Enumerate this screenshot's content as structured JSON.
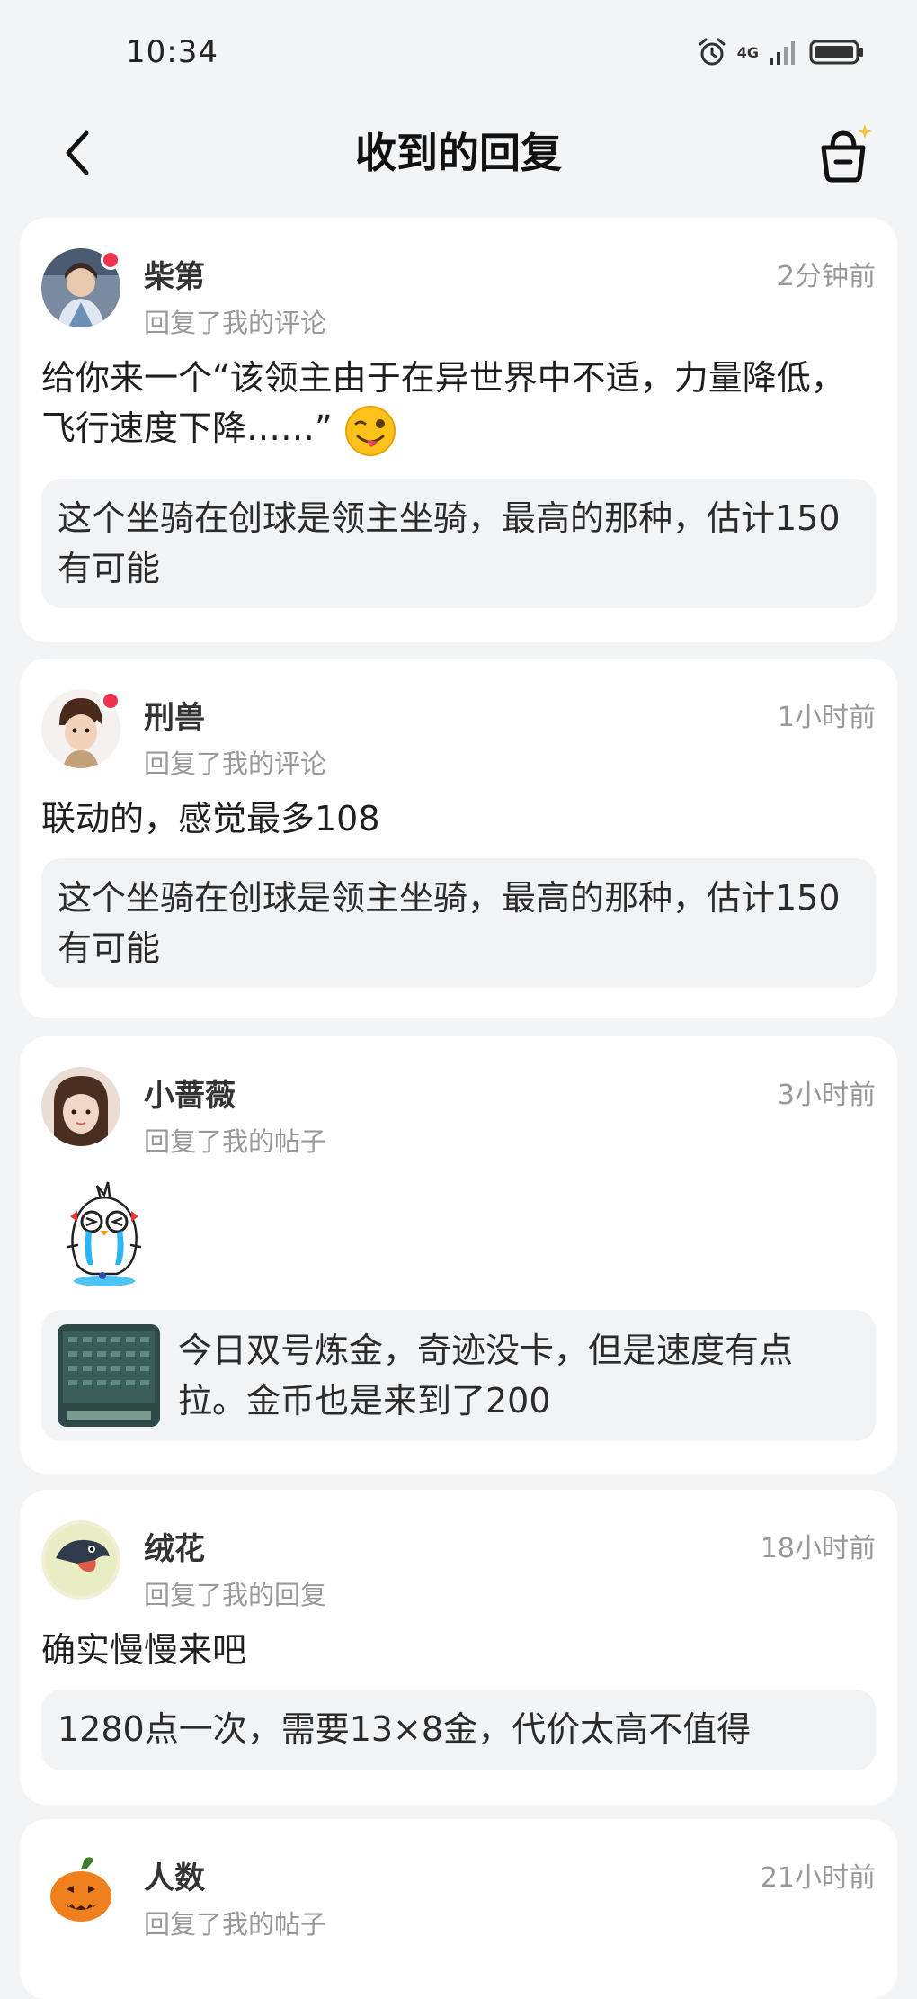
{
  "status": {
    "time": "10:34",
    "network": "4G"
  },
  "header": {
    "title": "收到的回复"
  },
  "colors": {
    "unread_dot": "#f0334c",
    "card_bg": "#ffffff",
    "page_bg": "#f3f4f6",
    "quote_bg": "#f2f3f5"
  },
  "replies": [
    {
      "name": "柴第",
      "action": "回复了我的评论",
      "time": "2分钟前",
      "text": "给你来一个“该领主由于在异世界中不适，力量降低，飞行速度下降……”",
      "emoji": "winking-tongue-emoji",
      "quote": "这个坐骑在创球是领主坐骑，最高的那种，估计150有可能",
      "unread": true
    },
    {
      "name": "刑兽",
      "action": "回复了我的评论",
      "time": "1小时前",
      "text": "联动的，感觉最多108",
      "quote": "这个坐骑在创球是领主坐骑，最高的那种，估计150有可能",
      "unread": true
    },
    {
      "name": "小蔷薇",
      "action": "回复了我的帖子",
      "time": "3小时前",
      "sticker": "crying-chick-sticker",
      "quote": "今日双号炼金，奇迹没卡，但是速度有点拉。金币也是来到了200",
      "unread": false
    },
    {
      "name": "绒花",
      "action": "回复了我的回复",
      "time": "18小时前",
      "text": "确实慢慢来吧",
      "quote": "1280点一次，需要13×8金，代价太高不值得",
      "unread": false
    },
    {
      "name": "人数",
      "action": "回复了我的帖子",
      "time": "21小时前",
      "unread": false
    }
  ]
}
